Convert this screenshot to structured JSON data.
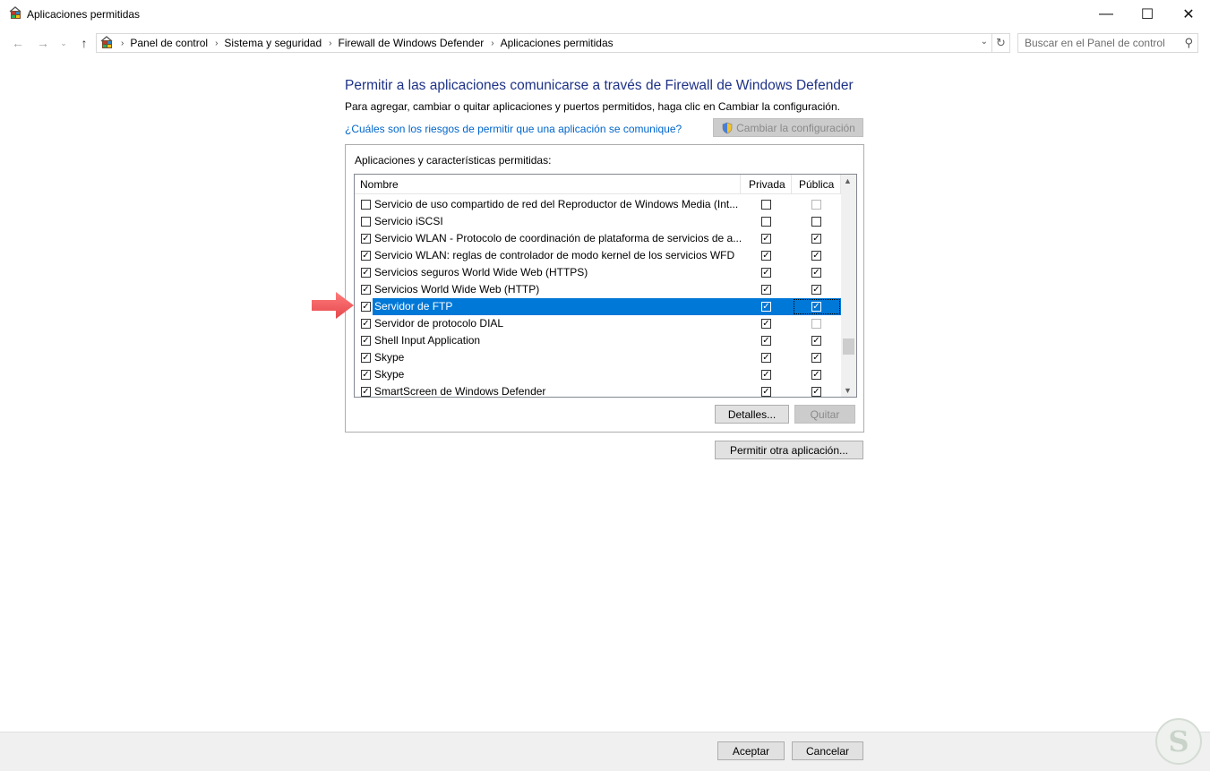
{
  "window": {
    "title": "Aplicaciones permitidas",
    "min_glyph": "—",
    "max_glyph": "☐",
    "close_glyph": "✕"
  },
  "nav": {
    "back_glyph": "←",
    "forward_glyph": "→",
    "recent_glyph": "⌄",
    "up_glyph": "↑",
    "breadcrumbs": [
      "Panel de control",
      "Sistema y seguridad",
      "Firewall de Windows Defender",
      "Aplicaciones permitidas"
    ],
    "separator": "›",
    "dropdown_glyph": "⌄",
    "refresh_glyph": "↻",
    "search_placeholder": "Buscar en el Panel de control",
    "search_glyph": "⚲"
  },
  "main": {
    "heading": "Permitir a las aplicaciones comunicarse a través de Firewall de Windows Defender",
    "subtext": "Para agregar, cambiar o quitar aplicaciones y puertos permitidos, haga clic en Cambiar la configuración.",
    "risk_link": "¿Cuáles son los riesgos de permitir que una aplicación se comunique?",
    "change_settings_label": "Cambiar la configuración",
    "group_label": "Aplicaciones y características permitidas:",
    "columns": {
      "name": "Nombre",
      "private": "Privada",
      "public": "Pública"
    },
    "rows": [
      {
        "name": "Servicio de uso compartido de red del Reproductor de Windows Media (Int...",
        "enabled": false,
        "private": false,
        "public": false,
        "public_disabled": true
      },
      {
        "name": "Servicio iSCSI",
        "enabled": false,
        "private": false,
        "public": false,
        "public_disabled": false
      },
      {
        "name": "Servicio WLAN - Protocolo de coordinación de plataforma de servicios de a...",
        "enabled": true,
        "private": true,
        "public": true,
        "public_disabled": false
      },
      {
        "name": "Servicio WLAN: reglas de controlador de modo kernel de los servicios WFD",
        "enabled": true,
        "private": true,
        "public": true,
        "public_disabled": false
      },
      {
        "name": "Servicios seguros World Wide Web (HTTPS)",
        "enabled": true,
        "private": true,
        "public": true,
        "public_disabled": false
      },
      {
        "name": "Servicios World Wide Web (HTTP)",
        "enabled": true,
        "private": true,
        "public": true,
        "public_disabled": false
      },
      {
        "name": "Servidor de FTP",
        "enabled": true,
        "private": true,
        "public": true,
        "public_disabled": false,
        "selected": true
      },
      {
        "name": "Servidor de protocolo DIAL",
        "enabled": true,
        "private": true,
        "public": false,
        "public_disabled": true
      },
      {
        "name": "Shell Input Application",
        "enabled": true,
        "private": true,
        "public": true,
        "public_disabled": false
      },
      {
        "name": "Skype",
        "enabled": true,
        "private": true,
        "public": true,
        "public_disabled": false
      },
      {
        "name": "Skype",
        "enabled": true,
        "private": true,
        "public": true,
        "public_disabled": false
      },
      {
        "name": "SmartScreen de Windows Defender",
        "enabled": true,
        "private": true,
        "public": true,
        "public_disabled": false
      }
    ],
    "details_label": "Detalles...",
    "remove_label": "Quitar",
    "allow_other_label": "Permitir otra aplicación..."
  },
  "footer": {
    "ok_label": "Aceptar",
    "cancel_label": "Cancelar"
  },
  "colors": {
    "heading": "#1e3287",
    "link": "#0066cc",
    "selection": "#0078d7",
    "annotation_arrow": "#f0575b"
  },
  "icons": {
    "app": "control-panel-icon",
    "shield": "uac-shield-icon",
    "annotation": "red-arrow-icon",
    "watermark": "solvetic-logo"
  }
}
